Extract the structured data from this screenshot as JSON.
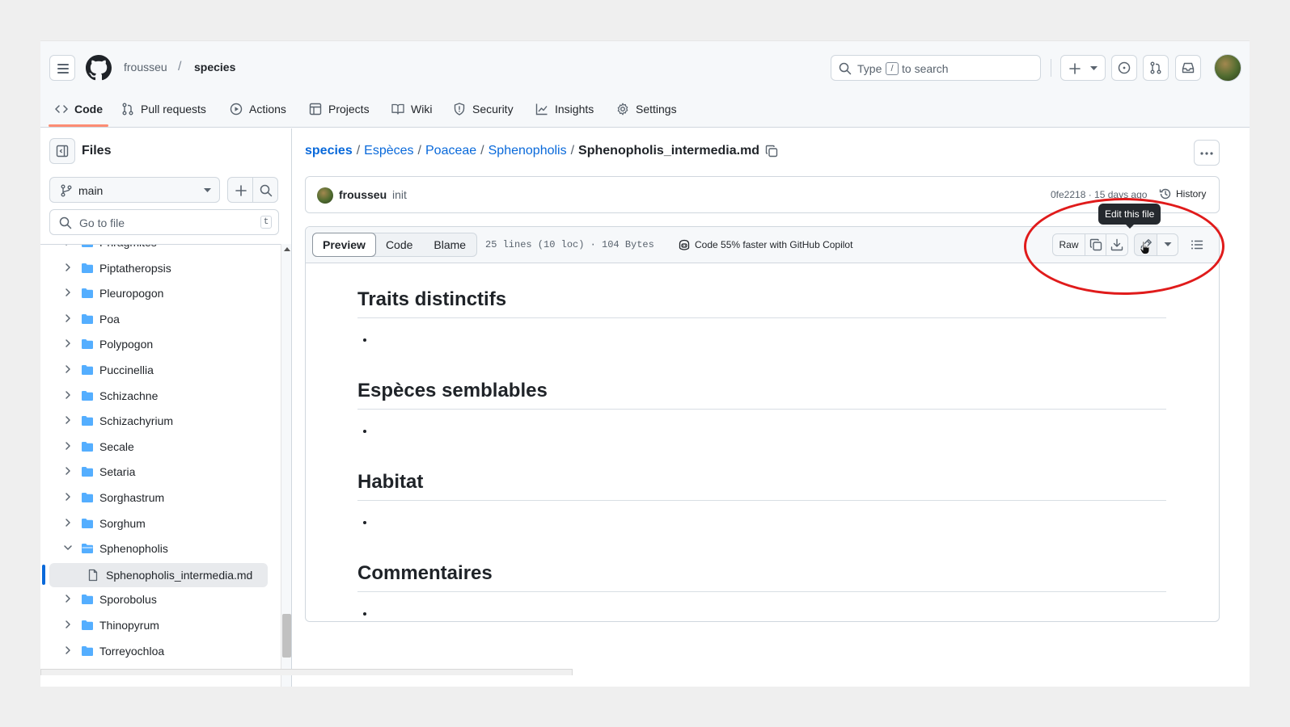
{
  "header": {
    "owner": "frousseu",
    "separator": "/",
    "repo": "species",
    "search": {
      "prefix": "Type",
      "key": "/",
      "suffix": "to search"
    }
  },
  "tabs": [
    {
      "label": "Code",
      "icon": "code-icon",
      "active": true
    },
    {
      "label": "Pull requests",
      "icon": "git-pull-request-icon"
    },
    {
      "label": "Actions",
      "icon": "play-icon"
    },
    {
      "label": "Projects",
      "icon": "table-icon"
    },
    {
      "label": "Wiki",
      "icon": "book-icon"
    },
    {
      "label": "Security",
      "icon": "shield-icon"
    },
    {
      "label": "Insights",
      "icon": "graph-icon"
    },
    {
      "label": "Settings",
      "icon": "gear-icon"
    }
  ],
  "sidebar": {
    "title": "Files",
    "branch": "main",
    "goto_placeholder": "Go to file",
    "goto_key": "t",
    "partial_item": "Phragmites",
    "items": [
      "Piptatheropsis",
      "Pleuropogon",
      "Poa",
      "Polypogon",
      "Puccinellia",
      "Schizachne",
      "Schizachyrium",
      "Secale",
      "Setaria",
      "Sorghastrum",
      "Sorghum",
      "Sphenopholis"
    ],
    "open_folder": "Sphenopholis",
    "selected_file": "Sphenopholis_intermedia.md",
    "items_after": [
      "Sporobolus",
      "Thinopyrum",
      "Torreyochloa"
    ]
  },
  "breadcrumb": {
    "repo": "species",
    "path": [
      "Espèces",
      "Poaceae",
      "Sphenopholis"
    ],
    "file": "Sphenopholis_intermedia.md"
  },
  "commit": {
    "author": "frousseu",
    "message": "init",
    "sha_age": "0fe2218 · 15 days ago",
    "history": "History"
  },
  "file_toolbar": {
    "views": [
      "Preview",
      "Code",
      "Blame"
    ],
    "active_view": "Preview",
    "stats": "25 lines (10 loc) · 104 Bytes",
    "copilot": "Code 55% faster with GitHub Copilot",
    "raw": "Raw",
    "tooltip": "Edit this file"
  },
  "content": {
    "sections": [
      "Traits distinctifs",
      "Espèces semblables",
      "Habitat",
      "Commentaires"
    ]
  },
  "colors": {
    "accent": "#0969da",
    "folder": "#54aeff",
    "tab_underline": "#fd8c73",
    "annotation": "#e01b1b"
  }
}
